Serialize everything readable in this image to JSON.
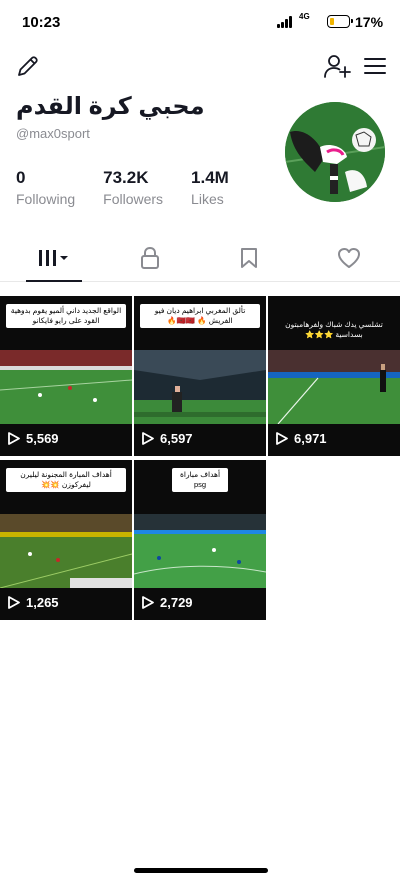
{
  "status_bar": {
    "time": "10:23",
    "network": "4G",
    "battery_percent": "17%",
    "battery_level": 0.17
  },
  "profile": {
    "name": "محبي كرة القدم",
    "handle": "@max0sport"
  },
  "stats": [
    {
      "value": "0",
      "label": "Following"
    },
    {
      "value": "73.2K",
      "label": "Followers"
    },
    {
      "value": "1.4M",
      "label": "Likes"
    }
  ],
  "tabs": [
    {
      "icon": "videos-grid-icon",
      "active": true
    },
    {
      "icon": "lock-icon",
      "active": false
    },
    {
      "icon": "bookmark-icon",
      "active": false
    },
    {
      "icon": "heart-icon",
      "active": false
    }
  ],
  "videos": [
    {
      "caption": "الواقع الجديد داني ألميو يقوم بدوهية القود على رايو فايكانو",
      "views": "5,569"
    },
    {
      "caption": "تألق المغربي ابراهيم ديان فيو الفريش 🔥 🇲🇦🇲🇦🔥",
      "views": "6,597"
    },
    {
      "caption": "تشلسي يدك شباك ولفرهامبتون بسداسية ⭐⭐⭐",
      "views": "6,971"
    },
    {
      "caption": "أهداف المبارة المجنونة ليليرن ليفركوزن 💥💥",
      "views": "1,265"
    },
    {
      "caption": "أهداف مباراة psg",
      "views": "2,729"
    }
  ],
  "colors": {
    "text_primary": "#161823",
    "text_secondary": "#8a8b91",
    "pitch_green": "#3f8f3a",
    "battery_low": "#f0b400"
  }
}
